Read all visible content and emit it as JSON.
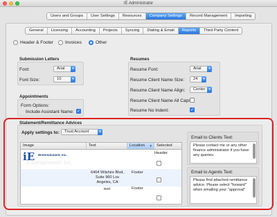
{
  "window": {
    "title": "IE Administrator"
  },
  "top_tabs": [
    {
      "label": "Users and Groups",
      "active": false
    },
    {
      "label": "User Settings",
      "active": false
    },
    {
      "label": "Resources",
      "active": false
    },
    {
      "label": "Company Settings",
      "active": true
    },
    {
      "label": "Record Management",
      "active": false
    },
    {
      "label": "Importing",
      "active": false
    }
  ],
  "sub_tabs": [
    {
      "label": "General",
      "active": false
    },
    {
      "label": "Licensing",
      "active": false
    },
    {
      "label": "Accounting",
      "active": false
    },
    {
      "label": "Projects",
      "active": false
    },
    {
      "label": "Syncing",
      "active": false
    },
    {
      "label": "Dialing & Email",
      "active": false
    },
    {
      "label": "Reports",
      "active": true
    },
    {
      "label": "Third Party Content",
      "active": false
    }
  ],
  "report_type": {
    "options": [
      "Header & Footer",
      "Invoices",
      "Other"
    ],
    "selected": "Other"
  },
  "submission_letters": {
    "title": "Submission Letters",
    "font_label": "Font:",
    "font_value": "Arial",
    "font_size_label": "Font Size:",
    "font_size_value": "10"
  },
  "resumes": {
    "title": "Resumes",
    "font_label": "Resume Font:",
    "font_value": "Arial",
    "name_size_label": "Resume Client Name  Size:",
    "name_size_value": "24",
    "name_align_label": "Resume Client Name Align:",
    "name_align_value": "Center",
    "all_caps_label": "Resume Client Name All Caps:",
    "all_caps_checked": false,
    "no_indent_label": "Resume No Indent:",
    "no_indent_checked": true
  },
  "appointments": {
    "title": "Appointments",
    "form_options_label": "Form Options:",
    "include_assistant_label": "Include Assistant Name:",
    "include_assistant_checked": true
  },
  "statement": {
    "title": "Statement/Remittance Advices",
    "apply_label": "Apply settings to:",
    "apply_value": "Trust Account",
    "table": {
      "columns": [
        "Image",
        "Text",
        "Location",
        "Selected"
      ],
      "sorted_column": "Location",
      "rows": [
        {
          "image_caption": "IEntertainment, Inc.",
          "image_glyph": "iE",
          "watermark": "Entertainment, Inc.",
          "text": "",
          "location": "Header",
          "selected": false
        },
        {
          "image_caption": "",
          "image_glyph": "",
          "watermark": "",
          "text": "6404 Wilshire Blvd, Suite 960 Los Angeles, CA",
          "location": "Footer",
          "selected": false
        },
        {
          "image_caption": "",
          "image_glyph": "",
          "watermark": "",
          "text": "test",
          "location": "Footer",
          "selected": false
        }
      ]
    },
    "clients_label": "Email to Clients Text:",
    "clients_text": "Please contact me or any other finance administrator if you have any queries.",
    "agents_label": "Email to Agents Text:",
    "agents_text": "Please find attached remittance advice. Please select \"forward\" when emailing your \"approval\""
  },
  "colors": {
    "accent": "#2c77e0",
    "highlight": "#e02020"
  },
  "icons": [
    "close-icon",
    "minimize-icon",
    "zoom-icon",
    "popup-arrow-icon",
    "checkmark-icon",
    "sort-arrow-icon"
  ]
}
